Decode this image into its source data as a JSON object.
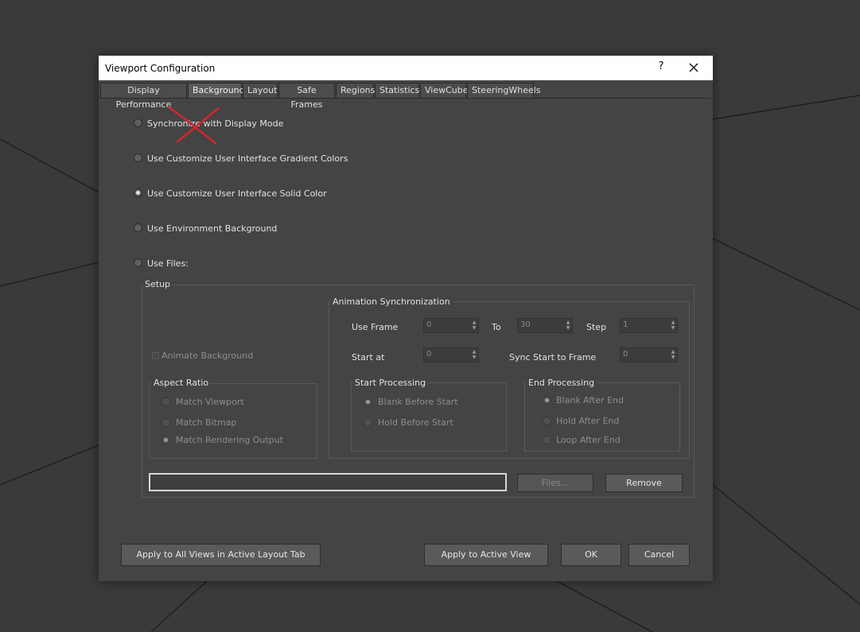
{
  "dialog": {
    "title": "Viewport Configuration",
    "help_label": "?"
  },
  "tabs": [
    {
      "label": "Display Performance",
      "active": false
    },
    {
      "label": "Background",
      "active": true
    },
    {
      "label": "Layout",
      "active": false
    },
    {
      "label": "Safe Frames",
      "active": false
    },
    {
      "label": "Regions",
      "active": false
    },
    {
      "label": "Statistics",
      "active": false
    },
    {
      "label": "ViewCube",
      "active": false
    },
    {
      "label": "SteeringWheels",
      "active": false
    }
  ],
  "background_options": [
    {
      "label": "Synchronize with Display Mode",
      "checked": false
    },
    {
      "label": "Use Customize User Interface Gradient Colors",
      "checked": false
    },
    {
      "label": "Use Customize User Interface Solid Color",
      "checked": true
    },
    {
      "label": "Use Environment Background",
      "checked": false
    },
    {
      "label": "Use Files:",
      "checked": false
    }
  ],
  "setup": {
    "title": "Setup",
    "animate_background": "Animate Background",
    "aspect_ratio": {
      "title": "Aspect Ratio",
      "options": [
        {
          "label": "Match Viewport",
          "checked": false
        },
        {
          "label": "Match Bitmap",
          "checked": false
        },
        {
          "label": "Match Rendering Output",
          "checked": true
        }
      ]
    },
    "animation_sync": {
      "title": "Animation Synchronization",
      "use_frame_label": "Use Frame",
      "use_frame_value": "0",
      "to_label": "To",
      "to_value": "30",
      "step_label": "Step",
      "step_value": "1",
      "start_at_label": "Start at",
      "start_at_value": "0",
      "sync_start_label": "Sync Start to Frame",
      "sync_start_value": "0"
    },
    "start_processing": {
      "title": "Start Processing",
      "options": [
        {
          "label": "Blank Before Start",
          "checked": true
        },
        {
          "label": "Hold Before Start",
          "checked": false
        }
      ]
    },
    "end_processing": {
      "title": "End Processing",
      "options": [
        {
          "label": "Blank After End",
          "checked": true
        },
        {
          "label": "Hold After End",
          "checked": false
        },
        {
          "label": "Loop After End",
          "checked": false
        }
      ]
    },
    "file_path": "",
    "files_button": "Files...",
    "remove_button": "Remove"
  },
  "footer": {
    "apply_all": "Apply to All Views in Active Layout Tab",
    "apply_active": "Apply to Active View",
    "ok": "OK",
    "cancel": "Cancel"
  },
  "annotation": {
    "type": "red-x-mark",
    "color": "#d9252a"
  },
  "colors": {
    "dialog_bg": "#444444",
    "viewport_bg": "#3a3a3a",
    "titlebar_bg": "#ffffff"
  }
}
